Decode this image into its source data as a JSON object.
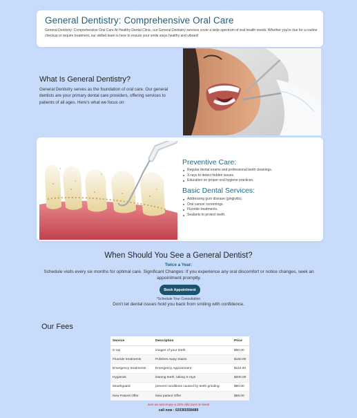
{
  "hero": {
    "title": "General Dentistry: Comprehensive Oral Care",
    "description": "General Dentistry: Comprehensive Oral Care At Healthy Dental Clinic, our General Dentistry services cover a wide spectrum of oral health needs. Whether you're due for a routine checkup or require treatment, our skilled team is here to ensure your smile stays healthy and vibrant!"
  },
  "what": {
    "title": "What Is General Dentistry?",
    "body": "General Dentistry serves as the foundation of oral care. Our general dentists are your primary dental care providers, offering services to patients of all ages. Here's what we focus on:"
  },
  "services": {
    "preventive_title": "Preventive Care:",
    "preventive_items": [
      "Regular dental exams and professional teeth cleanings.",
      "X-rays to detect hidden issues.",
      "Education on proper oral hygiene practices."
    ],
    "basic_title": "Basic Dental Services:",
    "basic_items": [
      "Addressing gum disease (gingivitis).",
      "Oral cancer screenings.",
      "Fluoride treatments.",
      "Sealants to protect teeth."
    ]
  },
  "when": {
    "title": "When Should You See a General Dentist?",
    "subtitle": "Twice a Year:",
    "body": "Schedule visits every six months for optimal care. Significant Changes: If you experience any oral discomfort or notice changes, seek an appointment promptly.",
    "button_label": "Book Appointment",
    "schedule_note": "*Schedule Your Consultation",
    "hold_back": "Don't let dental issues hold you back from smiling with confidence."
  },
  "fees": {
    "title": "Our Fees",
    "headers": [
      "Service",
      "Description",
      "Price"
    ],
    "rows": [
      [
        "X-ray",
        "images of your teeth",
        "$50.00"
      ],
      [
        "Fluoride treatments",
        "Polishes Away Stains",
        "$150.00"
      ],
      [
        "Emergency treatments",
        "Emergency Appointment",
        "$110.00"
      ],
      [
        "Hygienist",
        "leaning teeth, taking X-rays",
        "$200.00"
      ],
      [
        "Mouthguard",
        "prevent conditions caused by teeth grinding",
        "$80.00"
      ],
      [
        "New Patient Offer",
        "New patient Offer",
        "$69.00"
      ]
    ]
  },
  "footer": {
    "discount": "Join us and enjoy a 20% discount on fees!",
    "call": "call now : 020365558489"
  },
  "colors": {
    "page_background": "#c9dbfb",
    "heading_teal": "#1e5d7e",
    "button": "#1b5470",
    "discount_red": "#d0302a"
  }
}
